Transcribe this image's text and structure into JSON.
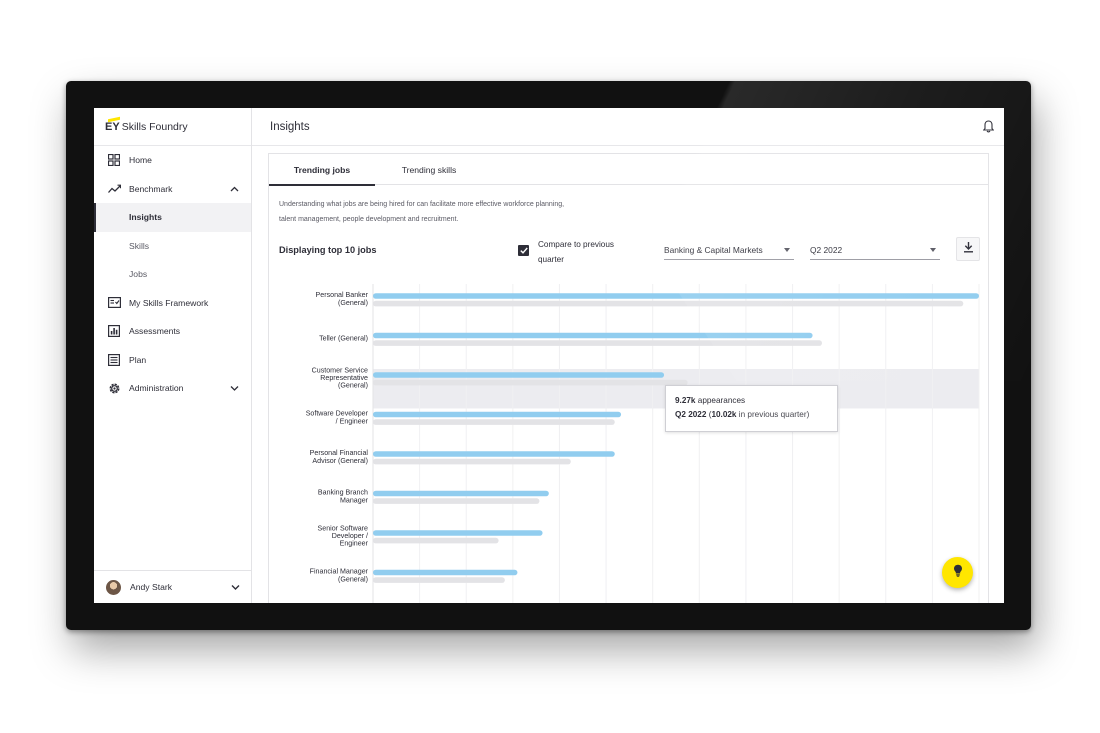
{
  "app": {
    "brand_mark": "EY",
    "brand_name": "Skills Foundry"
  },
  "header": {
    "title": "Insights"
  },
  "sidebar": {
    "items": [
      {
        "label": "Home"
      },
      {
        "label": "Benchmark"
      },
      {
        "label": "Insights"
      },
      {
        "label": "Skills"
      },
      {
        "label": "Jobs"
      },
      {
        "label": "My Skills Framework"
      },
      {
        "label": "Assessments"
      },
      {
        "label": "Plan"
      },
      {
        "label": "Administration"
      }
    ],
    "user": {
      "name": "Andy Stark"
    }
  },
  "main": {
    "tabs": [
      {
        "label": "Trending jobs"
      },
      {
        "label": "Trending skills"
      }
    ],
    "description_line1": "Understanding what jobs are being hired for can facilitate more effective workforce planning,",
    "description_line2": "talent management, people development and recruitment.",
    "display_title": "Displaying top 10 jobs",
    "compare_label_line1": "Compare to previous",
    "compare_label_line2": "quarter",
    "compare_checked": true,
    "sector_select": "Banking & Capital Markets",
    "quarter_select": "Q2 2022"
  },
  "tooltip": {
    "value": "9.27k",
    "value_suffix": " appearances",
    "quarter": "Q2 2022",
    "previous_value": "10.02k",
    "previous_suffix": " in previous quarter)"
  },
  "colors": {
    "current": "#91cdef",
    "previous": "#e3e3e6",
    "accent": "#ffe600",
    "text": "#2e2e38"
  },
  "chart_data": {
    "type": "bar",
    "orientation": "horizontal",
    "categories": [
      [
        "Personal Banker",
        "(General)"
      ],
      [
        "Teller (General)"
      ],
      [
        "Customer Service",
        "Representative",
        "(General)"
      ],
      [
        "Software Developer",
        "/ Engineer"
      ],
      [
        "Personal Financial",
        "Advisor (General)"
      ],
      [
        "Banking Branch",
        "Manager"
      ],
      [
        "Senior Software",
        "Developer /",
        "Engineer"
      ],
      [
        "Financial Manager",
        "(General)"
      ]
    ],
    "series": [
      {
        "key": "current",
        "values": [
          19.3,
          14.0,
          9.27,
          7.9,
          7.7,
          5.6,
          5.4,
          4.6
        ]
      },
      {
        "key": "previous",
        "values": [
          18.8,
          14.3,
          10.02,
          7.7,
          6.3,
          5.3,
          4.0,
          4.2
        ]
      }
    ],
    "xlim": [
      0,
      19.3
    ],
    "highlighted_index": 2,
    "grid": true
  },
  "icons": {
    "home": "home-grid-icon",
    "benchmark": "trend-icon",
    "framework": "framework-icon",
    "assessments": "assessment-icon",
    "plan": "plan-icon",
    "administration": "gear-icon",
    "notifications": "bell-icon",
    "download": "download-icon",
    "tip": "lightbulb-icon"
  }
}
